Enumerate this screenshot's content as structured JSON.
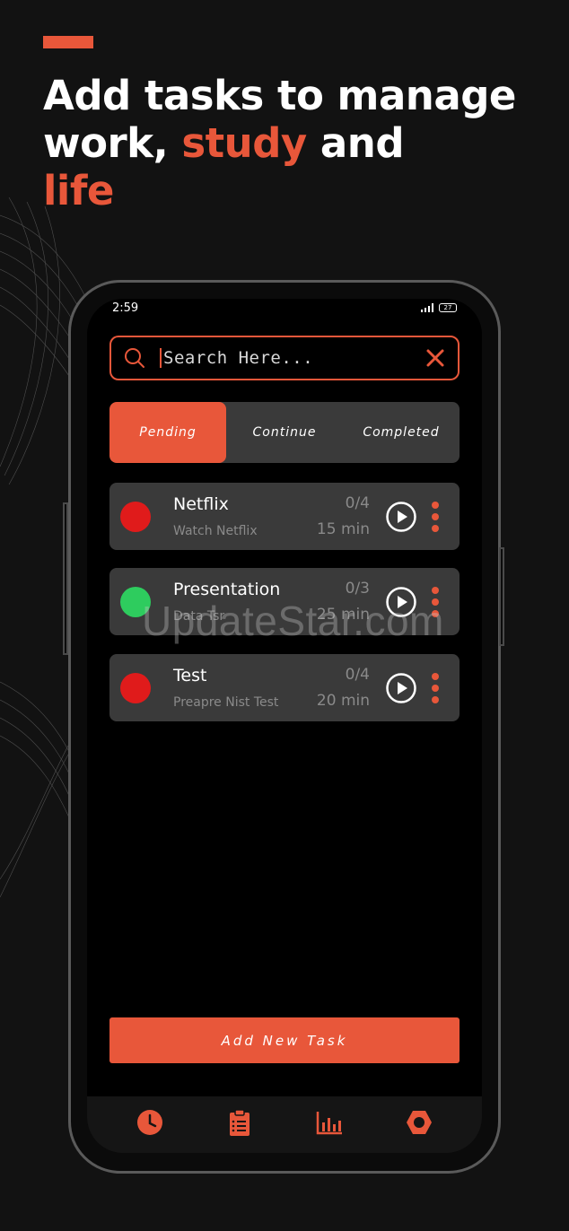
{
  "headline": {
    "line1": "Add tasks to manage",
    "line2_a": "work, ",
    "line2_b": "study",
    "line2_c": " and",
    "line3": "life"
  },
  "status_bar": {
    "time": "2:59",
    "battery": "27"
  },
  "search": {
    "placeholder": "Search Here..."
  },
  "tabs": [
    {
      "label": "Pending",
      "active": true
    },
    {
      "label": "Continue",
      "active": false
    },
    {
      "label": "Completed",
      "active": false
    }
  ],
  "tasks": [
    {
      "title": "Netflix",
      "subtitle": "Watch Netflix",
      "count": "0/4",
      "duration": "15 min",
      "dot_color": "#e01b1b"
    },
    {
      "title": "Presentation",
      "subtitle": "Data Tsr",
      "count": "0/3",
      "duration": "25 min",
      "dot_color": "#2ecc5e"
    },
    {
      "title": "Test",
      "subtitle": "Preapre Nist Test",
      "count": "0/4",
      "duration": "20 min",
      "dot_color": "#e01b1b"
    }
  ],
  "add_button": {
    "label": "Add New Task"
  },
  "bottom_nav": [
    {
      "icon": "clock-icon"
    },
    {
      "icon": "clipboard-icon"
    },
    {
      "icon": "bar-chart-icon"
    },
    {
      "icon": "hexagon-settings-icon"
    }
  ],
  "watermark": "UpdateStar.com",
  "colors": {
    "accent": "#e8573a",
    "card": "#3a3a3a",
    "background": "#121212"
  }
}
